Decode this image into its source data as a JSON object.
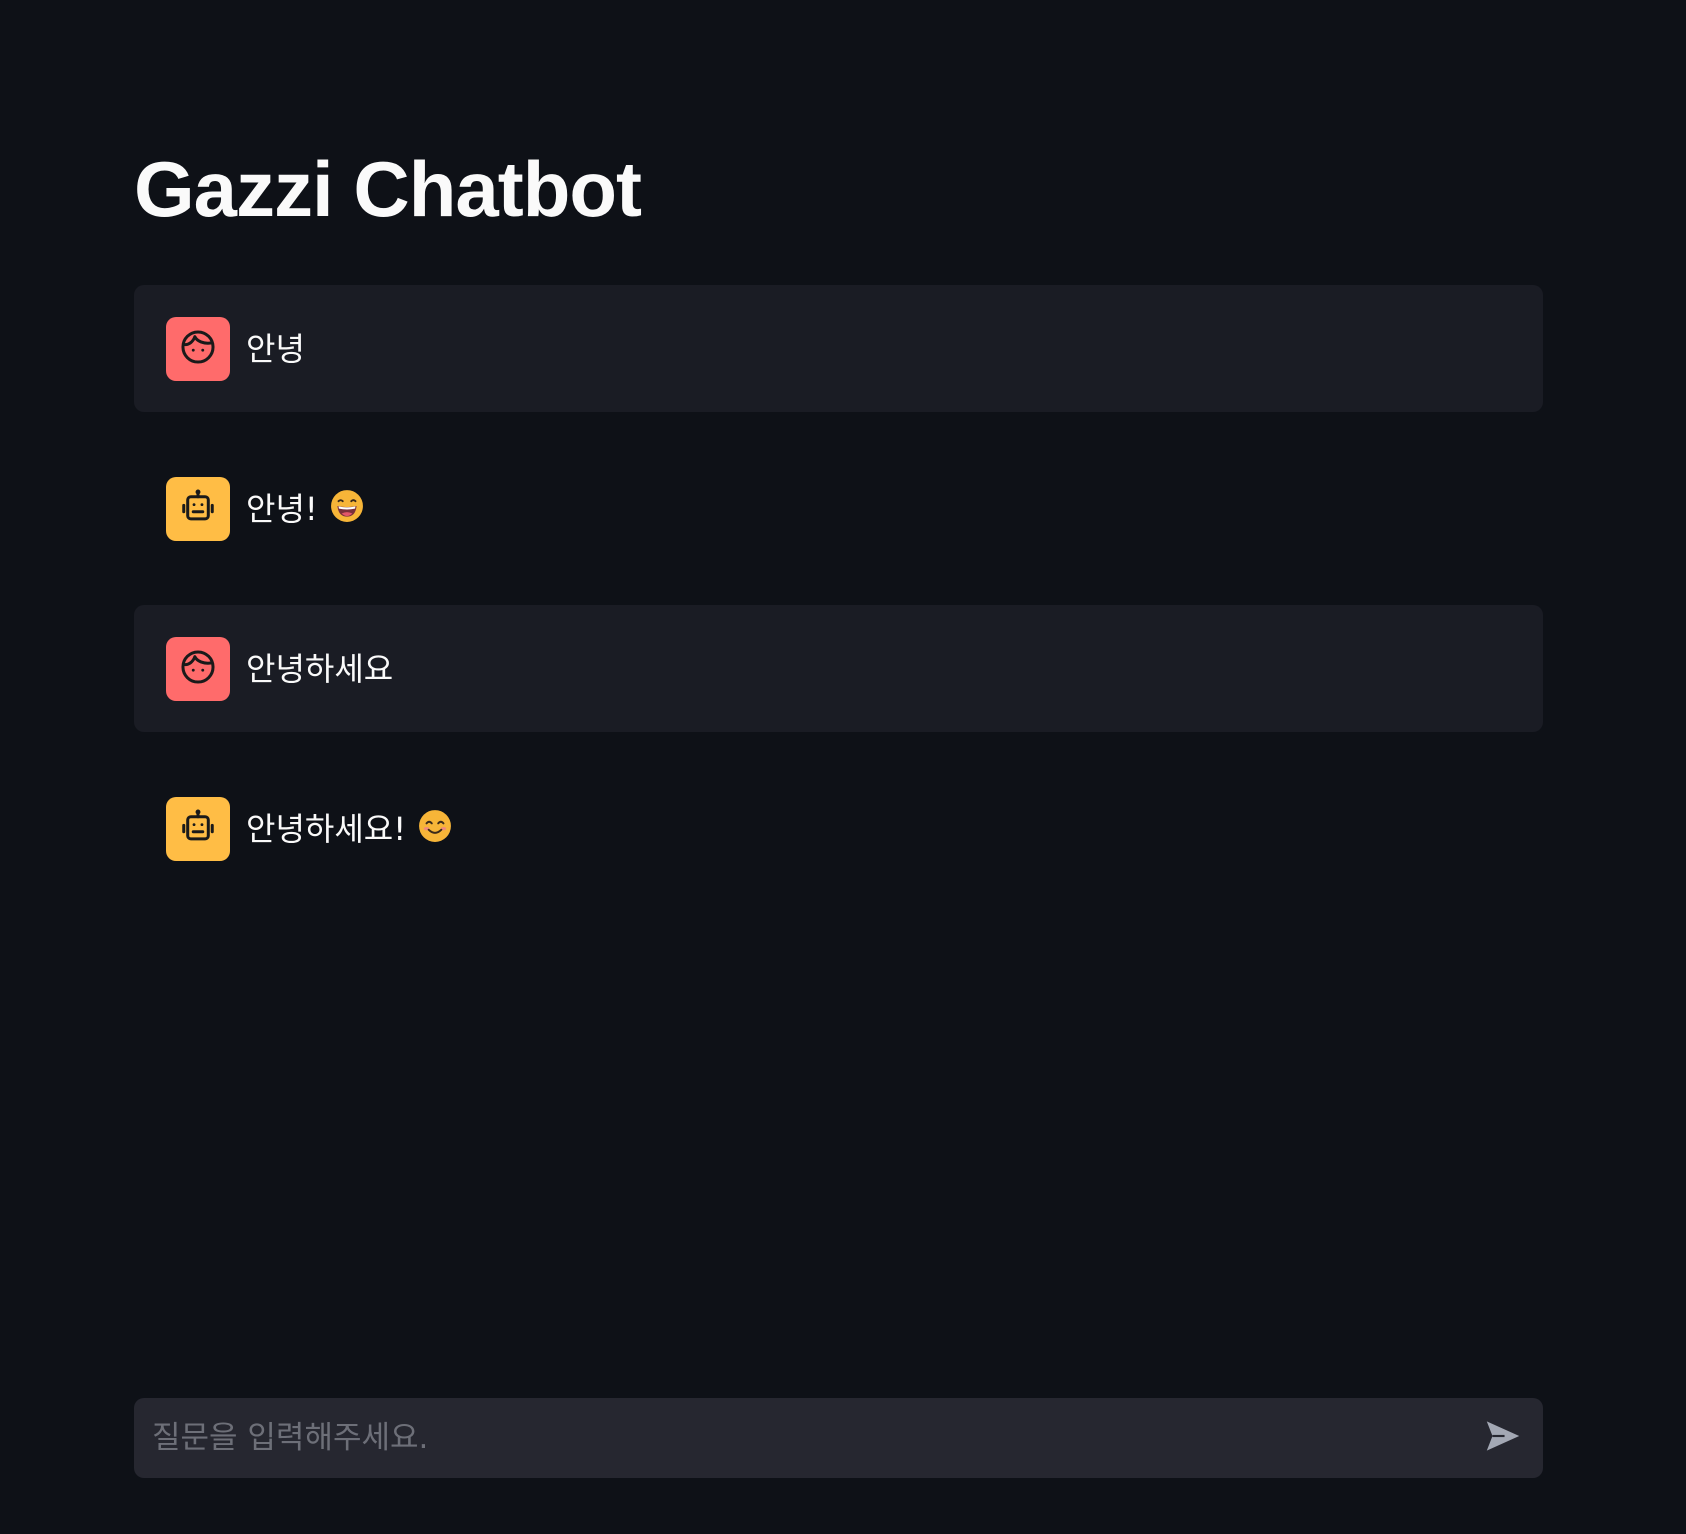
{
  "page": {
    "title": "Gazzi Chatbot"
  },
  "messages": [
    {
      "role": "user",
      "text": "안녕",
      "emoji": "",
      "avatar_icon": "face-icon"
    },
    {
      "role": "assistant",
      "text": "안녕!",
      "emoji": "grinning-face-emoji",
      "avatar_icon": "robot-icon"
    },
    {
      "role": "user",
      "text": "안녕하세요",
      "emoji": "",
      "avatar_icon": "face-icon"
    },
    {
      "role": "assistant",
      "text": "안녕하세요!",
      "emoji": "smiling-face-emoji",
      "avatar_icon": "robot-icon"
    }
  ],
  "chat_input": {
    "placeholder": "질문을 입력해주세요.",
    "value": "",
    "send_icon": "send-icon"
  },
  "colors": {
    "background": "#0e1117",
    "user_message_bg": "#1a1c24",
    "user_avatar": "#ff6b6b",
    "assistant_avatar": "#ffbd45",
    "input_bg": "#262730",
    "text": "#fafafa",
    "placeholder": "#6d6f78",
    "send_icon": "#a3a8b4"
  }
}
